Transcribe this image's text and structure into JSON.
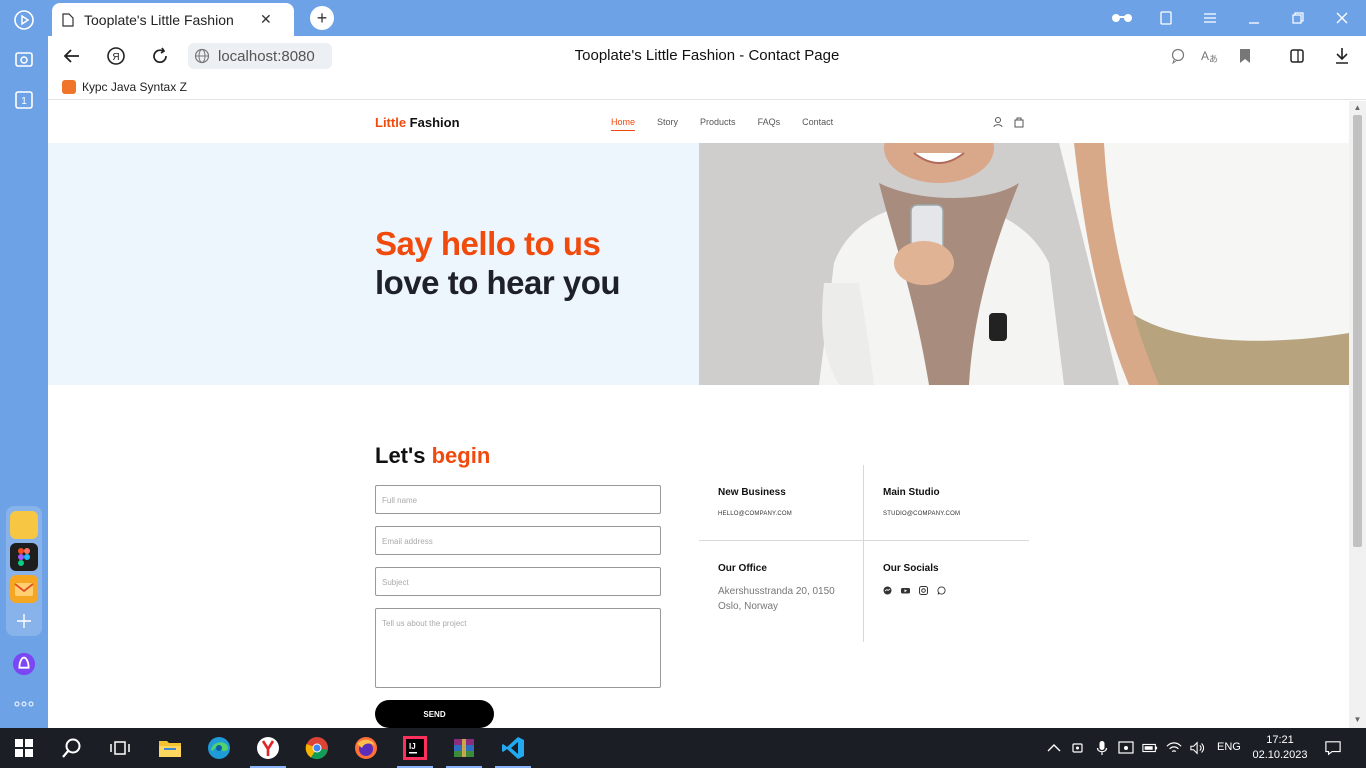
{
  "browser": {
    "tab_title": "Tooplate's Little Fashion",
    "url": "localhost:8080",
    "page_title": "Tooplate's Little Fashion - Contact Page",
    "bookmark": "Курс Java Syntax Z"
  },
  "site": {
    "brand_accent": "Little",
    "brand_rest": " Fashion",
    "nav": [
      "Home",
      "Story",
      "Products",
      "FAQs",
      "Contact"
    ],
    "active_nav": "Home",
    "accent_color": "#f14a0d",
    "hero_line1": "Say hello to us",
    "hero_line2": "love to hear you",
    "form_title_part1": "Let's ",
    "form_title_part2": "begin",
    "fields": {
      "name_placeholder": "Full name",
      "email_placeholder": "Email address",
      "subject_placeholder": "Subject",
      "message_placeholder": "Tell us about the project"
    },
    "send_label": "SEND",
    "info": {
      "new_business_title": "New Business",
      "new_business_email": "HELLO@COMPANY.COM",
      "main_studio_title": "Main Studio",
      "main_studio_email": "STUDIO@COMPANY.COM",
      "office_title": "Our Office",
      "office_address_1": "Akershusstranda 20, 0150",
      "office_address_2": "Oslo, Norway",
      "socials_title": "Our Socials",
      "socials": [
        "messenger-icon",
        "youtube-icon",
        "instagram-icon",
        "whatsapp-icon"
      ]
    }
  },
  "taskbar": {
    "language": "ENG",
    "time": "17:21",
    "date": "02.10.2023"
  }
}
